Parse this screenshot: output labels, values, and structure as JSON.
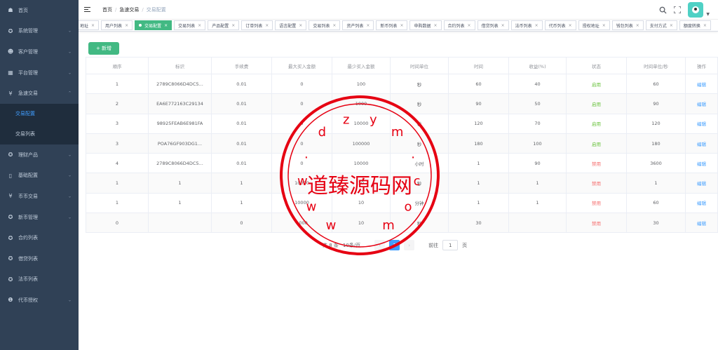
{
  "sidebar": {
    "items": [
      {
        "label": "首页",
        "icon": "dashboard-icon",
        "glyph": "☗",
        "arrow": ""
      },
      {
        "label": "系统管理",
        "icon": "gear-icon",
        "glyph": "✪",
        "arrow": "⌄"
      },
      {
        "label": "客户管理",
        "icon": "user-icon",
        "glyph": "☻",
        "arrow": "⌄"
      },
      {
        "label": "平台管理",
        "icon": "grid-icon",
        "glyph": "▦",
        "arrow": "⌄"
      },
      {
        "label": "急速交易",
        "icon": "yen-icon",
        "glyph": "¥",
        "arrow": "⌃"
      }
    ],
    "submenu": [
      "交易配置",
      "交易列表"
    ],
    "items2": [
      {
        "label": "理财产品",
        "icon": "gear-icon",
        "glyph": "✪",
        "arrow": "⌄"
      },
      {
        "label": "基础配置",
        "icon": "book-icon",
        "glyph": "▯",
        "arrow": "⌄"
      },
      {
        "label": "币币交易",
        "icon": "yen-icon",
        "glyph": "¥",
        "arrow": "⌄"
      },
      {
        "label": "新币管理",
        "icon": "gear-icon",
        "glyph": "✪",
        "arrow": "⌄"
      },
      {
        "label": "合约列表",
        "icon": "gear-icon",
        "glyph": "✪",
        "arrow": ""
      },
      {
        "label": "借贷列表",
        "icon": "gear-icon",
        "glyph": "✪",
        "arrow": ""
      },
      {
        "label": "法币列表",
        "icon": "gear-icon",
        "glyph": "✪",
        "arrow": ""
      },
      {
        "label": "代币授权",
        "icon": "info-icon",
        "glyph": "❶",
        "arrow": "⌄"
      }
    ]
  },
  "breadcrumb": [
    "首页",
    "急速交易",
    "交易配置"
  ],
  "tags": [
    {
      "label": "地址",
      "active": false
    },
    {
      "label": "用户列表",
      "active": false
    },
    {
      "label": "交易配置",
      "active": true
    },
    {
      "label": "交易列表",
      "active": false
    },
    {
      "label": "产品配置",
      "active": false
    },
    {
      "label": "订单列表",
      "active": false
    },
    {
      "label": "语言配置",
      "active": false
    },
    {
      "label": "交易列表",
      "active": false
    },
    {
      "label": "资产列表",
      "active": false
    },
    {
      "label": "新币列表",
      "active": false
    },
    {
      "label": "申购数据",
      "active": false
    },
    {
      "label": "合约列表",
      "active": false
    },
    {
      "label": "借贷列表",
      "active": false
    },
    {
      "label": "法币列表",
      "active": false
    },
    {
      "label": "代币列表",
      "active": false
    },
    {
      "label": "授权地址",
      "active": false
    },
    {
      "label": "钱包列表",
      "active": false
    },
    {
      "label": "支付方式",
      "active": false
    },
    {
      "label": "额度转换",
      "active": false
    }
  ],
  "add_button": "+ 新增",
  "table": {
    "headers": [
      "顺序",
      "标识",
      "手续费",
      "最大买入金额",
      "最少买入金额",
      "时间单位",
      "时间",
      "收益(%)",
      "状态",
      "时间单位/秒",
      "操作"
    ],
    "rows": [
      [
        "1",
        "2789C8066D4DC5...",
        "0.01",
        "0",
        "100",
        "秒",
        "60",
        "40",
        "启用",
        "60",
        "编辑"
      ],
      [
        "2",
        "EA6E772163C29134",
        "0.01",
        "0",
        "1000",
        "秒",
        "90",
        "50",
        "启用",
        "90",
        "编辑"
      ],
      [
        "3",
        "98925FEAB6E981FA",
        "0.01",
        "0",
        "10000",
        "秒",
        "120",
        "70",
        "启用",
        "120",
        "编辑"
      ],
      [
        "3",
        "POA76GF903DG1...",
        "0.01",
        "0",
        "100000",
        "秒",
        "180",
        "100",
        "启用",
        "180",
        "编辑"
      ],
      [
        "4",
        "2789C8066D4DC5...",
        "0.01",
        "0",
        "10000",
        "小时",
        "1",
        "90",
        "禁用",
        "3600",
        "编辑"
      ],
      [
        "1",
        "1",
        "1",
        "10000",
        "10",
        "秒",
        "1",
        "1",
        "禁用",
        "1",
        "编辑"
      ],
      [
        "1",
        "1",
        "1",
        "10000",
        "10",
        "分钟",
        "1",
        "1",
        "禁用",
        "60",
        "编辑"
      ],
      [
        "0",
        "",
        "0",
        "1000",
        "10",
        "秒",
        "30",
        "",
        "禁用",
        "30",
        "编辑"
      ]
    ],
    "status_on": "启用"
  },
  "pagination": {
    "total": "共 8 条",
    "page_size": "10条/页",
    "current": "1",
    "goto_label": "前往",
    "goto_value": "1",
    "page_suffix": "页"
  },
  "watermark": {
    "text": "道臻源码网",
    "url": "www.dzym.com",
    "color": "#e60012"
  }
}
